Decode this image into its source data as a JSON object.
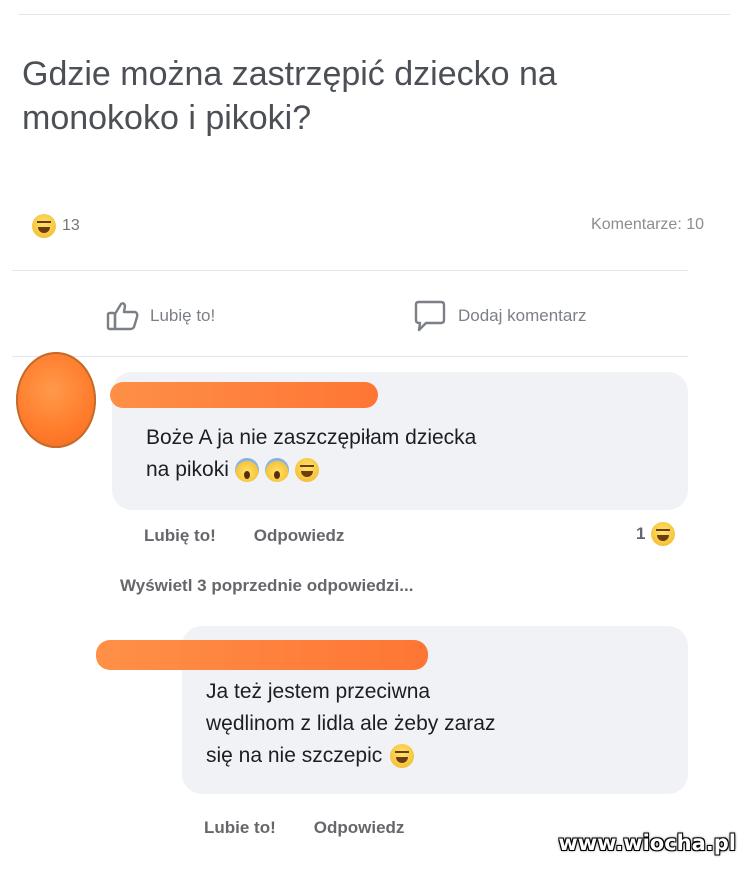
{
  "post": {
    "title_line1": "Gdzie można zastrzępić dziecko na",
    "title_line2": "monokoko i pikoki?",
    "reactions_count": "13",
    "comments_label": "Komentarze: 10",
    "like_label": "Lubię to!",
    "comment_label": "Dodaj komentarz"
  },
  "comments": [
    {
      "text_line1": "Boże A ja nie zaszczępiłam dziecka",
      "text_line2": "na pikoki",
      "like_action": "Lubię to!",
      "reply_action": "Odpowiedz",
      "reaction_count": "1",
      "emojis": [
        "scream-icon",
        "scream-icon",
        "laugh-icon"
      ]
    },
    {
      "text_line1": "Ja też jestem przeciwna",
      "text_line2": "wędlinom z lidla ale żeby zaraz",
      "text_line3": "się na nie szczepic",
      "like_action": "Lubie to!",
      "reply_action": "Odpowiedz",
      "emojis": [
        "laugh-icon"
      ]
    }
  ],
  "view_previous_replies": "Wyświetl 3 poprzednie odpowiedzi...",
  "watermark": "www.wiocha.pl",
  "colors": {
    "redaction": "#ff7a2a",
    "bubble": "#f0f2f5",
    "secondary_text": "#65676b"
  }
}
